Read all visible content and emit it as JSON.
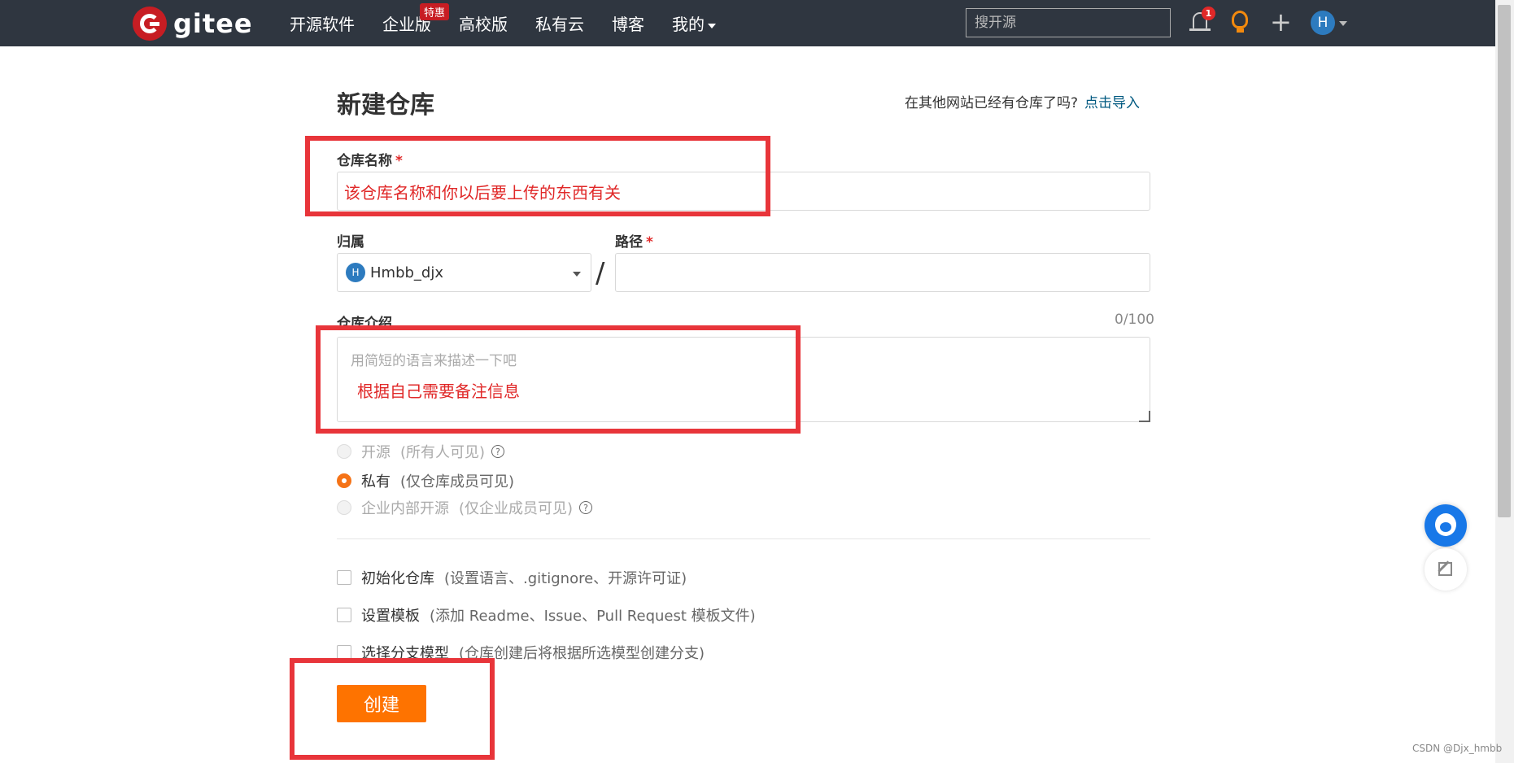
{
  "header": {
    "logo_text": "gitee",
    "nav": [
      {
        "label": "开源软件"
      },
      {
        "label": "企业版",
        "badge": "特惠"
      },
      {
        "label": "高校版"
      },
      {
        "label": "私有云"
      },
      {
        "label": "博客"
      },
      {
        "label": "我的"
      }
    ],
    "search_placeholder": "搜开源",
    "notification_count": "1",
    "user_initial": "H"
  },
  "form": {
    "title": "新建仓库",
    "import_hint": "在其他网站已经有仓库了吗?",
    "import_link": "点击导入",
    "name_label": "仓库名称",
    "required_mark": "*",
    "name_value": "该仓库名称和你以后要上传的东西有关",
    "owner_label": "归属",
    "owner_initial": "H",
    "owner_value": "Hmbb_djx",
    "path_label": "路径",
    "slash": "/",
    "path_value": "",
    "desc_label": "仓库介绍",
    "desc_counter": "0/100",
    "desc_placeholder": "用简短的语言来描述一下吧",
    "desc_note": "根据自己需要备注信息",
    "visibility": [
      {
        "label": "开源",
        "note": "(所有人可见)",
        "selected": false,
        "disabled": true,
        "help": true
      },
      {
        "label": "私有",
        "note": "(仅仓库成员可见)",
        "selected": true,
        "disabled": false,
        "help": false
      },
      {
        "label": "企业内部开源",
        "note": "(仅企业成员可见)",
        "selected": false,
        "disabled": true,
        "help": true
      }
    ],
    "options": [
      {
        "label": "初始化仓库",
        "note": "(设置语言、.gitignore、开源许可证)",
        "checked": false
      },
      {
        "label": "设置模板",
        "note": "(添加 Readme、Issue、Pull Request 模板文件)",
        "checked": false
      },
      {
        "label": "选择分支模型",
        "note": "(仓库创建后将根据所选模型创建分支)",
        "checked": false
      }
    ],
    "submit_label": "创建"
  },
  "colors": {
    "header_bg": "#2f3640",
    "accent_orange": "#fe7300",
    "annotation_red": "#e8353a",
    "link_blue": "#005980"
  },
  "watermark": "CSDN @Djx_hmbb"
}
